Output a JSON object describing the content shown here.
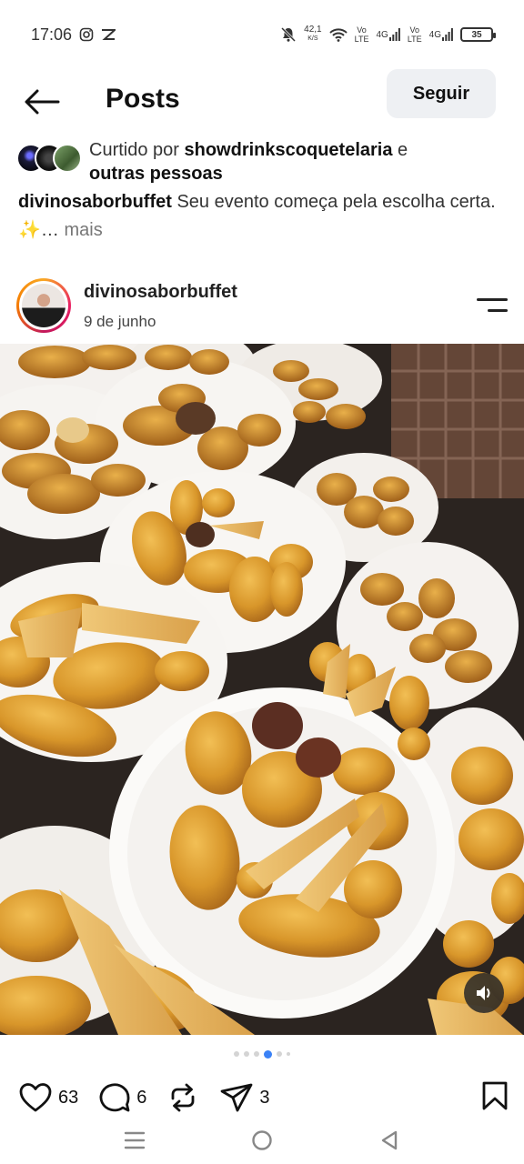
{
  "status_bar": {
    "time": "17:06",
    "net_speed_value": "42,1",
    "net_speed_unit": "K/S",
    "volte1": "Vo",
    "volte1b": "LTE",
    "signal1": "4G",
    "volte2": "Vo",
    "volte2b": "LTE",
    "signal2": "4G",
    "battery": "35"
  },
  "header": {
    "title": "Posts",
    "follow_label": "Seguir"
  },
  "liked_by": {
    "prefix": "Curtido por ",
    "user": "showdrinkscoquetelaria",
    "suffix": " e",
    "others": "outras pessoas"
  },
  "caption": {
    "user": "divinosaborbuffet",
    "text": " Seu evento começa pela escolha certa. ✨…",
    "more": " mais"
  },
  "post": {
    "username": "divinosaborbuffet",
    "date": "9 de junho"
  },
  "carousel": {
    "total": 6,
    "active_index": 3
  },
  "actions": {
    "likes": "63",
    "comments": "6",
    "shares": "3"
  },
  "icons": {
    "back": "arrow-left-icon",
    "menu": "menu-icon",
    "like": "heart-icon",
    "comment": "comment-icon",
    "repost": "repost-icon",
    "share": "send-icon",
    "save": "bookmark-icon",
    "sound": "speaker-icon"
  },
  "colors": {
    "accent": "#3b82f6",
    "follow_bg": "#eef0f3"
  }
}
